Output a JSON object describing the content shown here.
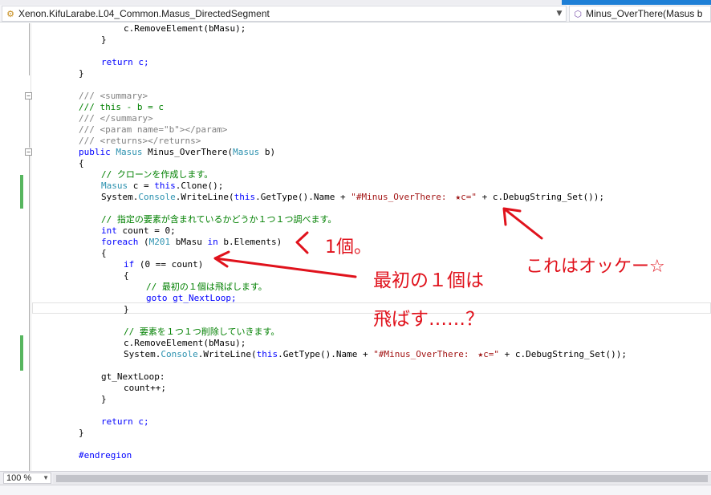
{
  "navigation": {
    "type_selector": "Xenon.KifuLarabe.L04_Common.Masus_DirectedSegment",
    "member_selector": "Minus_OverThere(Masus b"
  },
  "code_lines": {
    "l01": "c.RemoveElement(bMasu);",
    "l02": "}",
    "l04": "return c;",
    "l05": "}",
    "l07": "/// <summary>",
    "l08": "/// this - b = c",
    "l09": "/// </summary>",
    "l10": "/// <param name=\"b\"></param>",
    "l11": "/// <returns></returns>",
    "l12": "public Masus Minus_OverThere(Masus b)",
    "l13": "{",
    "l14": "// クローンを作成します。",
    "l15": "Masus c = this.Clone();",
    "l16": "System.Console.WriteLine(this.GetType().Name + \"#Minus_OverThere:　★c=\" + c.DebugString_Set());",
    "l18": "// 指定の要素が含まれているかどうか１つ１つ調べます。",
    "l19": "int count = 0;",
    "l20": "foreach (M201 bMasu in b.Elements)",
    "l21": "{",
    "l22": "if (0 == count)",
    "l23": "{",
    "l24": "// 最初の１個は飛ばします。",
    "l25": "goto gt_NextLoop;",
    "l26": "}",
    "l28": "// 要素を１つ１つ削除していきます。",
    "l29": "c.RemoveElement(bMasu);",
    "l30": "System.Console.WriteLine(this.GetType().Name + \"#Minus_OverThere:　★c=\" + c.DebugString_Set());",
    "l32": "gt_NextLoop:",
    "l33": "count++;",
    "l34": "}",
    "l36": "return c;",
    "l37": "}",
    "l39": "#endregion"
  },
  "annotations": {
    "one_item": "1個。",
    "okay": "これはオッケー☆",
    "skip_first_line1": "最初の１個は",
    "skip_first_line2": "飛ばす……？"
  },
  "statusbar": {
    "zoom": "100 %"
  },
  "colors": {
    "keyword": "#0000ff",
    "type": "#2b91af",
    "string": "#a31515",
    "comment": "#008000",
    "annotation": "#e0121c",
    "change_marker": "#57b65f"
  }
}
